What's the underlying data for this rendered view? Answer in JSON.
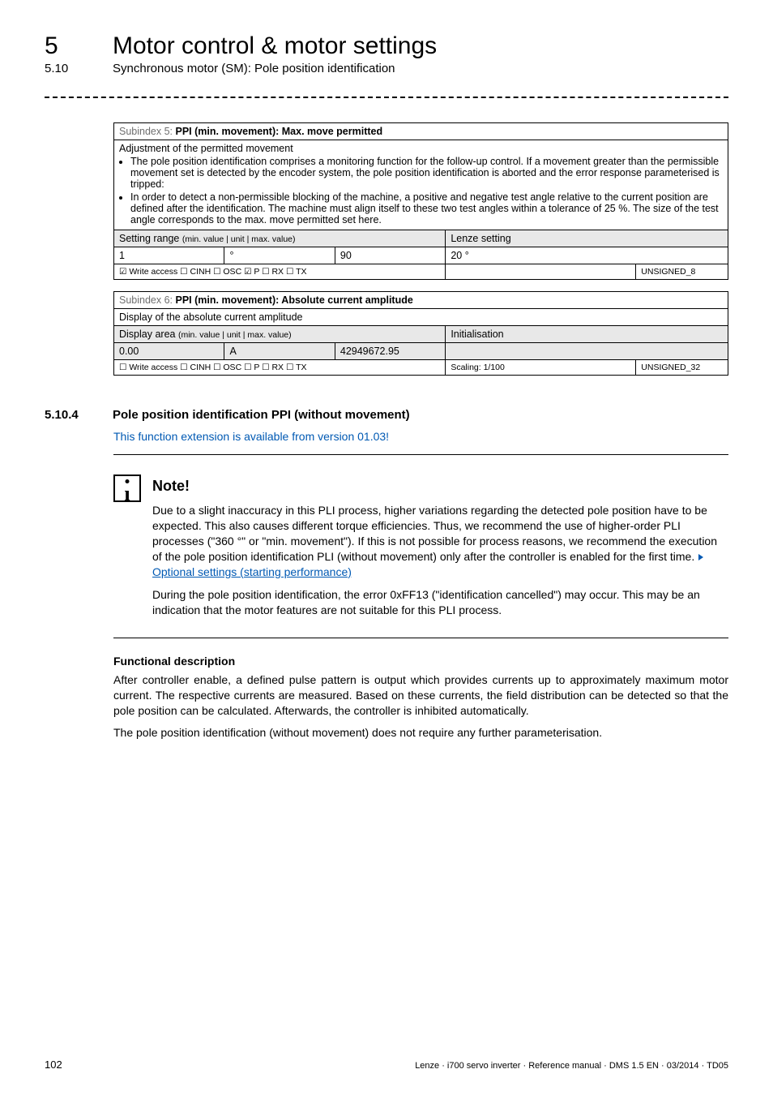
{
  "header": {
    "chapter_num": "5",
    "chapter_title": "Motor control & motor settings",
    "section_num": "5.10",
    "section_title": "Synchronous motor (SM): Pole position identification"
  },
  "table5": {
    "title_grey": "Subindex 5: ",
    "title_bold": "PPI (min. movement): Max. move permitted",
    "desc_lead": "Adjustment of the permitted movement",
    "bullets": [
      "The pole position identification comprises a monitoring function for the follow-up control. If a movement greater than the permissible movement set is detected by the encoder system, the pole position identification is aborted and the error response parameterised is tripped:",
      "In order to detect a non-permissible blocking of the machine, a positive and negative test angle relative to the current position are defined after the identification. The machine must align itself to these two test angles within a tolerance of 25 %. The size of the test angle corresponds to the max. move permitted set here."
    ],
    "setting_range_label": "Setting range",
    "setting_range_sub": "(min. value | unit | max. value)",
    "lenze_label": "Lenze setting",
    "min": "1",
    "unit": "°",
    "max": "90",
    "lenze_value": "20 °",
    "access": "☑ Write access   ☐ CINH   ☐ OSC   ☑ P   ☐ RX   ☐ TX",
    "type": "UNSIGNED_8"
  },
  "table6": {
    "title_grey": "Subindex 6: ",
    "title_bold": "PPI (min. movement): Absolute current amplitude",
    "desc": "Display of the absolute current amplitude",
    "display_area_label": "Display area",
    "display_area_sub": "(min. value | unit | max. value)",
    "init_label": "Initialisation",
    "min": "0.00",
    "unit": "A",
    "max": "42949672.95",
    "init_value": "",
    "access": "☐ Write access   ☐ CINH   ☐ OSC   ☐ P   ☐ RX   ☐ TX",
    "scaling": "Scaling: 1/100",
    "type": "UNSIGNED_32"
  },
  "section_5_10_4": {
    "num": "5.10.4",
    "title": "Pole position identification PPI (without movement)",
    "version_note": "This function extension is available from version 01.03!"
  },
  "note": {
    "title": "Note!",
    "p1": "Due to a slight inaccuracy in this PLI process, higher variations regarding the detected pole position have to be expected. This also causes different torque efficiencies. Thus, we recommend the use of higher-order PLI processes (\"360 °\" or \"min. movement\"). If this is not possible for process reasons, we recommend the execution of the pole position identification PLI (without movement) only after the controller is enabled for the first time. ",
    "link_text": "Optional settings (starting performance)",
    "p2": "During the pole position identification, the error 0xFF13 (\"identification cancelled\") may occur. This may be an indication that the motor features are not suitable for this PLI process."
  },
  "functional": {
    "heading": "Functional description",
    "p1": "After controller enable, a defined pulse pattern is output which provides currents up to approximately maximum motor current. The respective currents are measured. Based on these currents, the field distribution can be detected so that the pole position can be calculated. Afterwards, the controller is inhibited automatically.",
    "p2": "The pole position identification (without movement) does not require any further parameterisation."
  },
  "footer": {
    "page": "102",
    "doc": "Lenze · i700 servo inverter · Reference manual · DMS 1.5 EN · 03/2014 · TD05"
  }
}
